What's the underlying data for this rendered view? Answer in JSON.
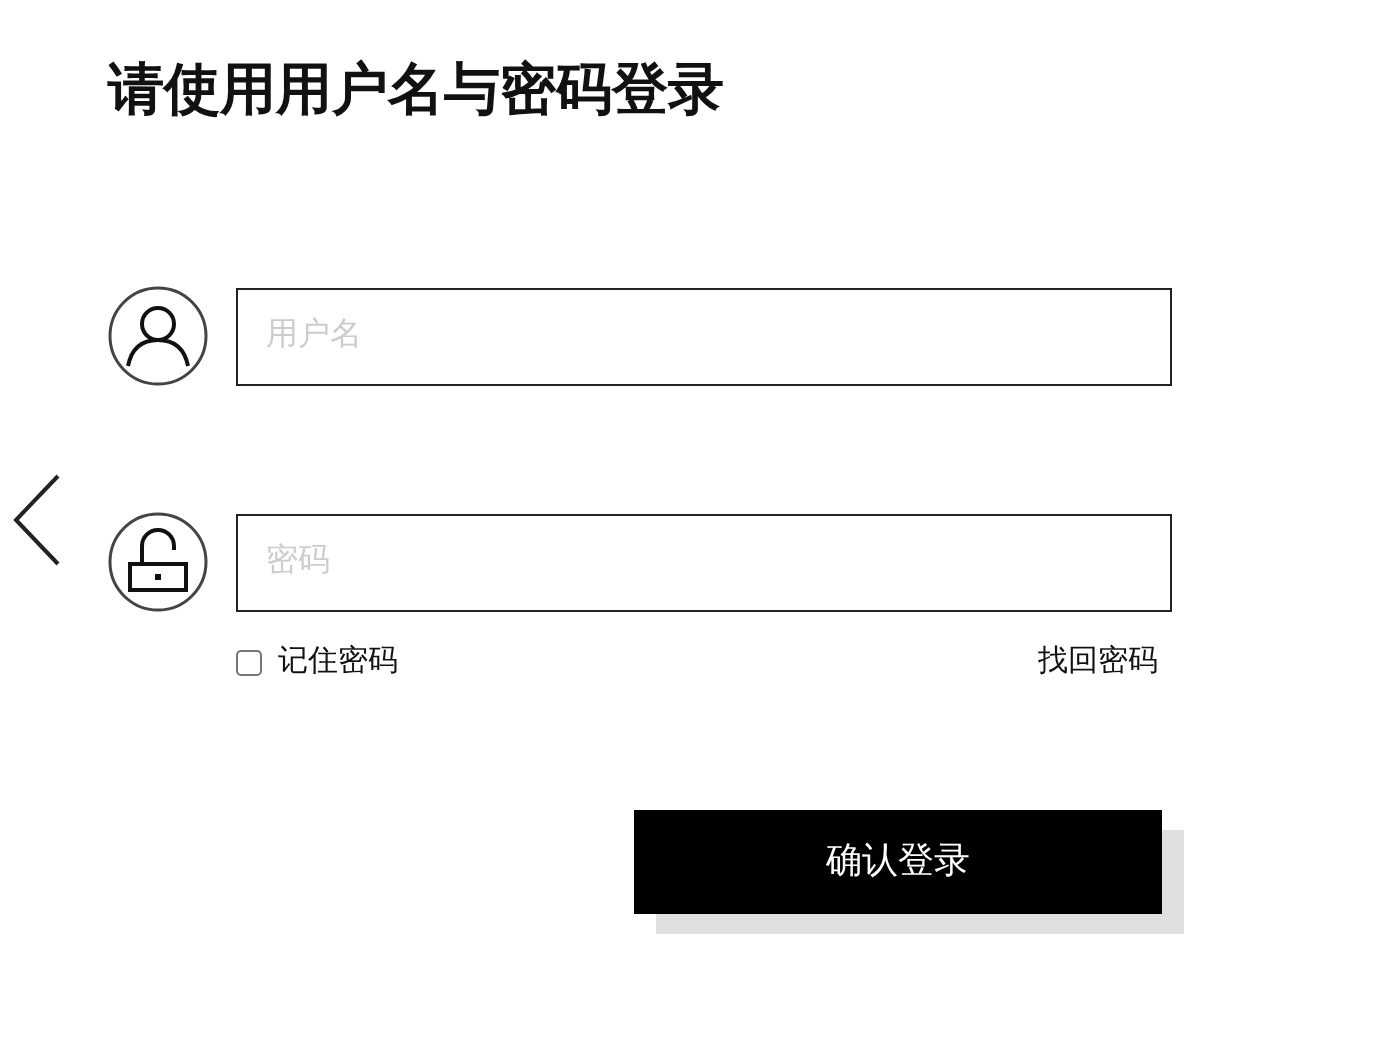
{
  "title": "请使用用户名与密码登录",
  "username": {
    "placeholder": "用户名"
  },
  "password": {
    "placeholder": "密码"
  },
  "remember": {
    "label": "记住密码",
    "checked": false
  },
  "forgot_link": "找回密码",
  "submit_button": "确认登录"
}
